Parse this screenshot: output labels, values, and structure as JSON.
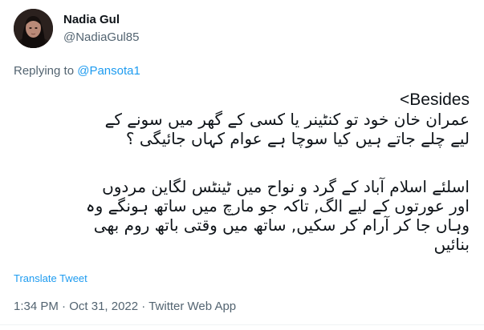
{
  "author": {
    "name": "Nadia Gul",
    "handle": "@NadiaGul85",
    "avatar_icon": "profile-photo"
  },
  "reply": {
    "prefix": "Replying to ",
    "mention": "@Pansota1"
  },
  "tweet": {
    "line1": "<Besides",
    "line2": "عمران خان خود تو کنٹینر یا کسی کے گھر میں سونے کے",
    "line3": "لیے چلے جاتے ہیں کیا سوچا ہے عوام کہاں جائیگی ؟",
    "line4": "اسلئے اسلام آباد کے گرد و نواح میں ٹینٹس لگاین مردوں",
    "line5": "اور عورتوں کے لیے الگ, تاکہ جو مارچ میں ساتھ ہونگے وہ",
    "line6": "وہاں جا کر آرام کر سکیں, ساتھ میں وقتی باتھ روم بھی",
    "line7": "بنائیں"
  },
  "translate_label": "Translate Tweet",
  "meta": {
    "time": "1:34 PM",
    "sep1": " · ",
    "date": "Oct 31, 2022",
    "sep2": " · ",
    "source": "Twitter Web App"
  },
  "colors": {
    "text": "#0f1419",
    "secondary": "#536471",
    "accent": "#1d9bf0"
  }
}
